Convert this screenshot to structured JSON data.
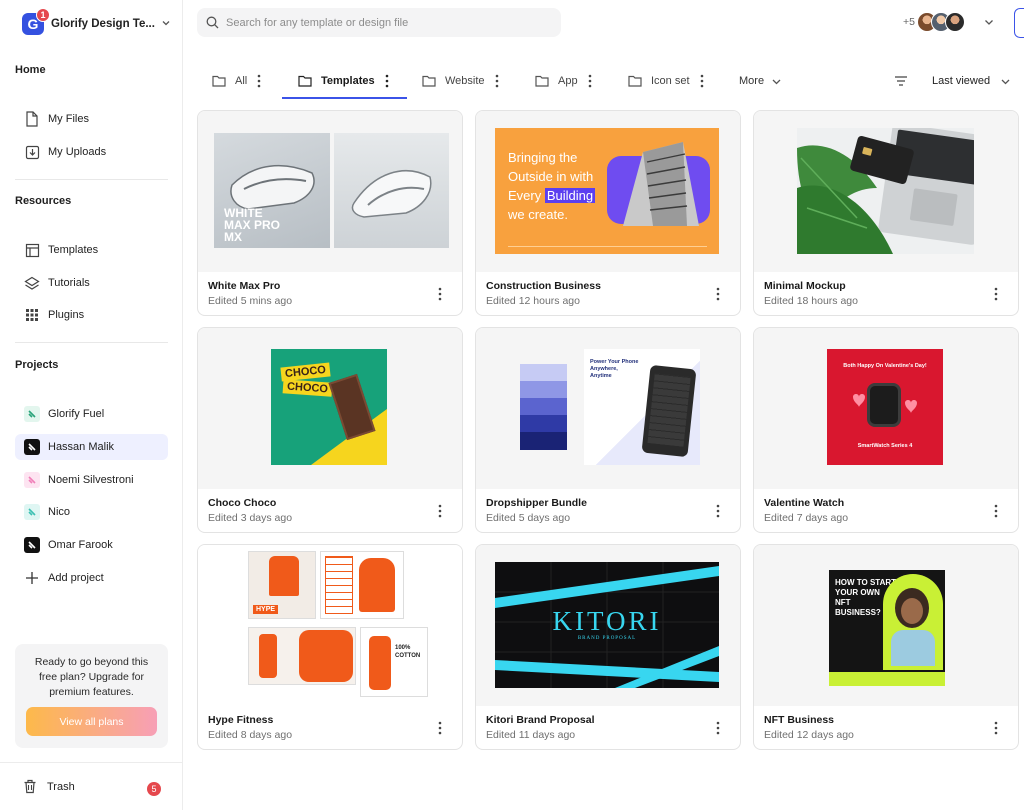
{
  "workspace": {
    "name": "Glorify Design Te...",
    "logo_letter": "G",
    "notification_count": "1"
  },
  "sidebar": {
    "home_label": "Home",
    "home_items": [
      {
        "label": "My Files",
        "icon": "file-icon"
      },
      {
        "label": "My Uploads",
        "icon": "upload-icon"
      }
    ],
    "resources_label": "Resources",
    "resource_items": [
      {
        "label": "Templates",
        "icon": "templates-icon"
      },
      {
        "label": "Tutorials",
        "icon": "layers-icon"
      },
      {
        "label": "Plugins",
        "icon": "grid-icon"
      }
    ],
    "projects_label": "Projects",
    "projects": [
      {
        "label": "Glorify Fuel",
        "color": "#2aa37a"
      },
      {
        "label": "Hassan Malik",
        "color": "#111111",
        "active": true
      },
      {
        "label": "Noemi Silvestroni",
        "color": "#f07fb8"
      },
      {
        "label": "Nico",
        "color": "#3cc0b2"
      },
      {
        "label": "Omar Farook",
        "color": "#111111"
      }
    ],
    "add_project_label": "Add project",
    "upgrade": {
      "text": "Ready to go beyond this free plan? Upgrade for premium features.",
      "button": "View all plans"
    },
    "trash": {
      "label": "Trash",
      "count": "5"
    }
  },
  "search": {
    "placeholder": "Search for any template or design file",
    "value": ""
  },
  "collaborators": {
    "extra_count": "+5"
  },
  "tabs": [
    {
      "label": "All"
    },
    {
      "label": "Templates",
      "active": true
    },
    {
      "label": "Website"
    },
    {
      "label": "App"
    },
    {
      "label": "Icon set"
    }
  ],
  "more_label": "More",
  "sort": {
    "label": "Last viewed"
  },
  "cards": [
    {
      "title": "White Max Pro",
      "meta": "Edited 5 mins ago",
      "art_text": "WHITE MAX PRO MX"
    },
    {
      "title": "Construction Business",
      "meta": "Edited 12 hours ago",
      "art_text_1": "Bringing the",
      "art_text_2": "Outside in with",
      "art_text_3a": "Every ",
      "art_text_3b": "Building",
      "art_text_4": "we create."
    },
    {
      "title": "Minimal Mockup",
      "meta": "Edited 18 hours ago"
    },
    {
      "title": "Choco Choco",
      "meta": "Edited 3 days ago",
      "art_text_1": "CHOCO",
      "art_text_2": "CHOCO"
    },
    {
      "title": "Dropshipper Bundle",
      "meta": "Edited 5 days ago",
      "art_text": "Power Your Phone Anywhere, Anytime"
    },
    {
      "title": "Valentine Watch",
      "meta": "Edited 7 days ago",
      "art_text_1": "Both Happy On Valentine's Day!",
      "art_text_2": "SmartWatch Series 4"
    },
    {
      "title": "Hype Fitness",
      "meta": "Edited 8 days ago",
      "art_text_1": "HYPE",
      "art_text_2": "100% COTTON"
    },
    {
      "title": "Kitori Brand Proposal",
      "meta": "Edited 11 days ago",
      "art_text_1": "KITORI",
      "art_text_2": "BRAND PROPOSAL"
    },
    {
      "title": "NFT Business",
      "meta": "Edited 12 days ago",
      "art_text": "HOW TO START YOUR OWN NFT BUSINESS?"
    }
  ],
  "colors": {
    "accent": "#3b53e8",
    "danger": "#e5484d",
    "active_bg": "#eef0ff"
  }
}
